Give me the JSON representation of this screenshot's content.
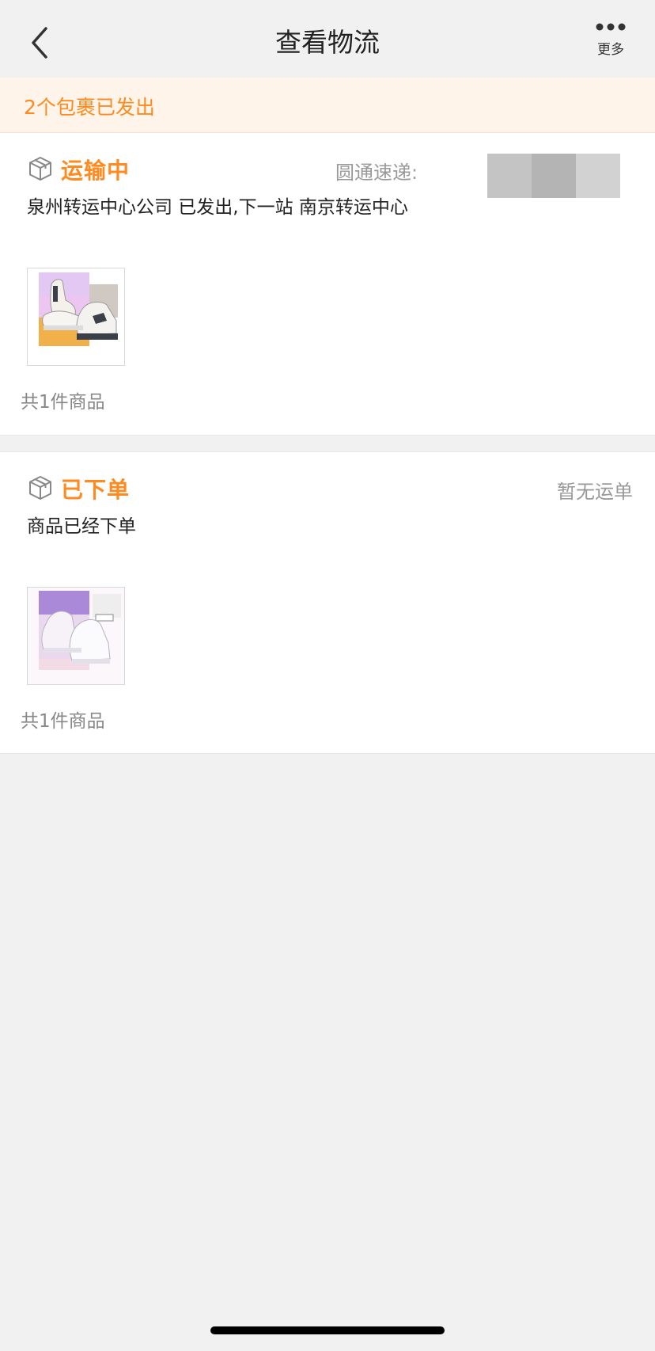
{
  "header": {
    "back_icon": "chevron-left-icon",
    "title": "查看物流",
    "more_icon": "ellipsis-icon",
    "more_label": "更多"
  },
  "banner": {
    "text": "2个包裹已发出"
  },
  "packages": [
    {
      "icon": "package-box-icon",
      "status": "运输中",
      "carrier": "圆通速递:",
      "description": "泉州转运中心公司 已发出,下一站 南京转运中心",
      "item_count": "共1件商品",
      "thumbnail": "sneaker-image-gray-white"
    },
    {
      "icon": "package-box-icon",
      "status": "已下单",
      "carrier": "暂无运单",
      "description": "商品已经下单",
      "item_count": "共1件商品",
      "thumbnail": "sneaker-image-white-purple"
    }
  ],
  "colors": {
    "accent": "#ff8a1f",
    "banner_bg": "#fff4ea",
    "page_bg": "#f1f1f1",
    "muted_text": "#999999"
  }
}
